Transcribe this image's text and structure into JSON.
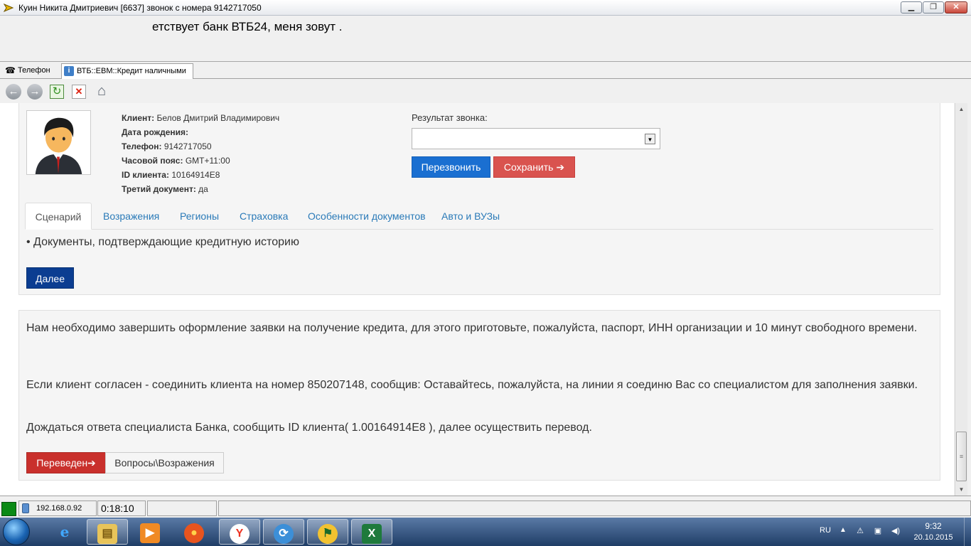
{
  "window": {
    "title": "Куин Никита Дмитриевич [6637] звонок с номера 9142717050",
    "btn_min": "▁",
    "btn_max": "❐",
    "btn_close": "✕"
  },
  "banner": {
    "text": "етствует банк ВТБ24, меня зовут ."
  },
  "doc_tabs": [
    {
      "label": "Телефон",
      "icon": "☎"
    },
    {
      "label": "ВТБ::ЕВМ::Кредит наличными",
      "icon": "i"
    }
  ],
  "toolbar": {
    "back_glyph": "←",
    "forward_glyph": "→",
    "refresh_glyph": "↻",
    "stop_glyph": "✕",
    "home_glyph": "⌂"
  },
  "client": {
    "name_label": "Клиент:",
    "name": "Белов Дмитрий Владимирович",
    "birth_label": "Дата рождения:",
    "birth": "",
    "phone_label": "Телефон:",
    "phone": "9142717050",
    "tz_label": "Часовой пояс:",
    "tz": "GMT+11:00",
    "id_label": "ID клиента:",
    "id": "10164914E8",
    "doc_label": "Третий документ:",
    "doc": "да"
  },
  "call_result": {
    "label": "Результат звонка:",
    "selected": "",
    "arrow": "▼",
    "recall_button": "Перезвонить",
    "save_button": "Сохранить ➔"
  },
  "tabs": [
    "Сценарий",
    "Возражения",
    "Регионы",
    "Страховка",
    "Особенности документов",
    "Авто и ВУЗы"
  ],
  "scenario": {
    "bullet": "• Документы, подтверждающие кредитную историю",
    "next_button": "Далее"
  },
  "transfer": {
    "para1": "Нам необходимо завершить оформление заявки на получение кредита, для этого приготовьте, пожалуйста, паспорт, ИНН организации и 10 минут свободного времени.",
    "para2": "Если клиент согласен - соединить клиента на номер 850207148, сообщив: Оставайтесь, пожалуйста, на линии я соединю Вас со специалистом для заполнения заявки.",
    "para3": "Дождаться ответа специалиста Банка, сообщить ID клиента( 1.00164914E8 ), далее осуществить перевод.",
    "transferred_button": "Переведен➔",
    "questions_button": "Вопросы\\Возражения"
  },
  "scrollbar": {
    "up": "▲",
    "down": "▼",
    "grip": "≡"
  },
  "statusbar": {
    "ip": "192.168.0.92",
    "timer": "0:18:10"
  },
  "taskbar": {
    "apps": [
      {
        "name": "internet-explorer",
        "glyph": "e"
      },
      {
        "name": "file-explorer",
        "glyph": "▤"
      },
      {
        "name": "media-player",
        "glyph": "▶"
      },
      {
        "name": "firefox",
        "glyph": "●"
      },
      {
        "name": "yandex",
        "glyph": "Y"
      },
      {
        "name": "sync",
        "glyph": "⟳"
      },
      {
        "name": "custom-app",
        "glyph": "⚑"
      },
      {
        "name": "excel",
        "glyph": "X"
      }
    ],
    "lang": "RU",
    "tray_up": "▲",
    "net_glyph": "⚠",
    "flag_glyph": "▣",
    "vol_glyph": "◀)",
    "time": "9:32",
    "date": "20.10.2015"
  },
  "colors": {
    "primary_blue": "#1a6fd1",
    "danger_red": "#d9534f",
    "dark_blue": "#0b3d91",
    "transfer_red": "#c9302c",
    "link_blue": "#2a7ab8",
    "status_green": "#0b8a16"
  }
}
